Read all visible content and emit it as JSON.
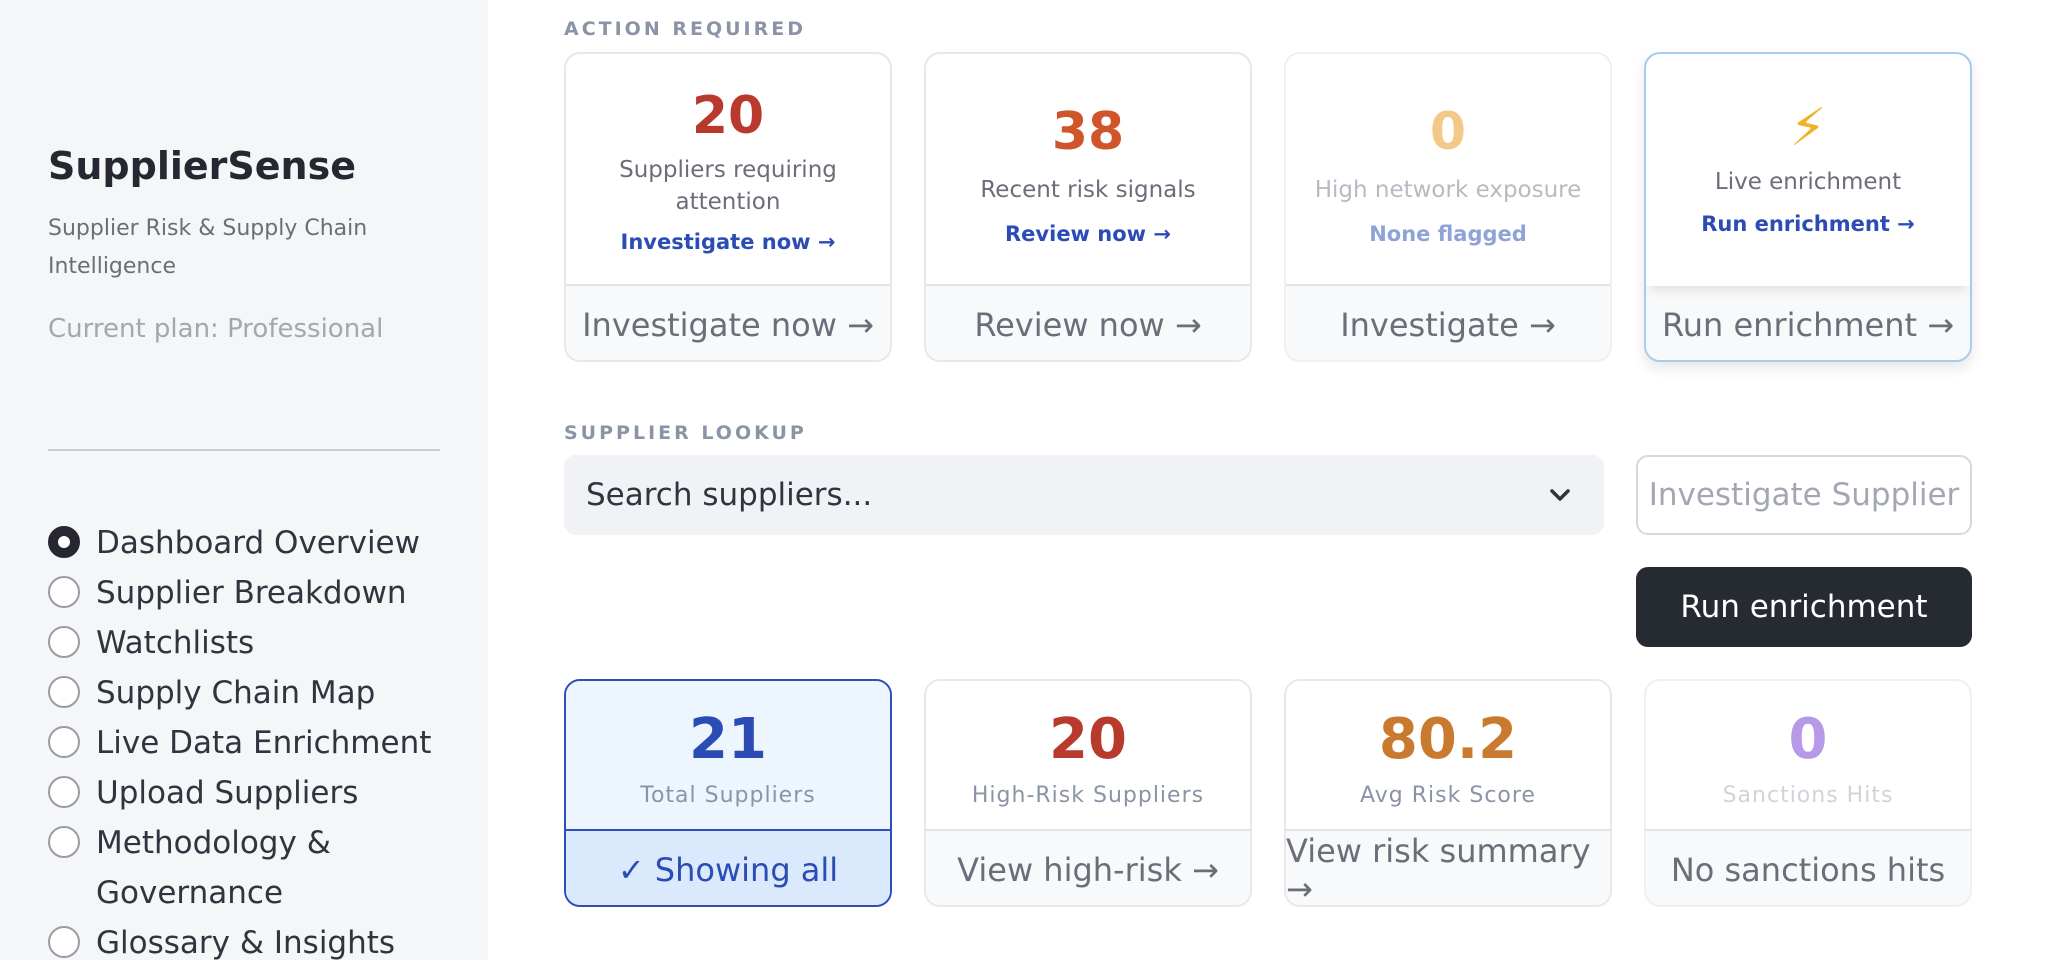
{
  "sidebar": {
    "app_name": "SupplierSense",
    "tagline": "Supplier Risk & Supply Chain Intelligence",
    "plan": "Current plan: Professional",
    "nav": [
      {
        "label": "Dashboard Overview",
        "selected": true
      },
      {
        "label": "Supplier Breakdown",
        "selected": false
      },
      {
        "label": "Watchlists",
        "selected": false
      },
      {
        "label": "Supply Chain Map",
        "selected": false
      },
      {
        "label": "Live Data Enrichment",
        "selected": false
      },
      {
        "label": "Upload Suppliers",
        "selected": false
      },
      {
        "label": "Methodology & Governance",
        "selected": false
      },
      {
        "label": "Glossary & Insights",
        "selected": false
      }
    ]
  },
  "action_required": {
    "heading": "ACTION REQUIRED",
    "cards": [
      {
        "value": "20",
        "text": "Suppliers requiring attention",
        "link": "Investigate now →",
        "button": "Investigate now →",
        "value_color": "#b83a2c"
      },
      {
        "value": "38",
        "text": "Recent risk signals",
        "link": "Review now →",
        "button": "Review now →",
        "value_color": "#d0552a"
      },
      {
        "value": "0",
        "text": "High network exposure",
        "link": "None flagged",
        "button": "Investigate →",
        "value_color": "#f3c98a"
      },
      {
        "icon": "lightning-icon",
        "icon_glyph": "⚡",
        "text": "Live enrichment",
        "link": "Run enrichment →",
        "button": "Run enrichment →",
        "value_color": "#f0b323"
      }
    ]
  },
  "supplier_lookup": {
    "heading": "SUPPLIER LOOKUP",
    "search_placeholder": "Search suppliers...",
    "investigate_button": "Investigate Supplier",
    "run_button": "Run enrichment"
  },
  "metrics": [
    {
      "value": "21",
      "label": "Total Suppliers",
      "button": "✓ Showing all",
      "value_color": "#2b4cb4"
    },
    {
      "value": "20",
      "label": "High-Risk Suppliers",
      "button": "View high-risk →",
      "value_color": "#b83a2c"
    },
    {
      "value": "80.2",
      "label": "Avg Risk Score",
      "button": "View risk summary →",
      "value_color": "#c97a2e"
    },
    {
      "value": "0",
      "label": "Sanctions Hits",
      "button": "No sanctions hits",
      "value_color": "#b69ae8"
    }
  ]
}
